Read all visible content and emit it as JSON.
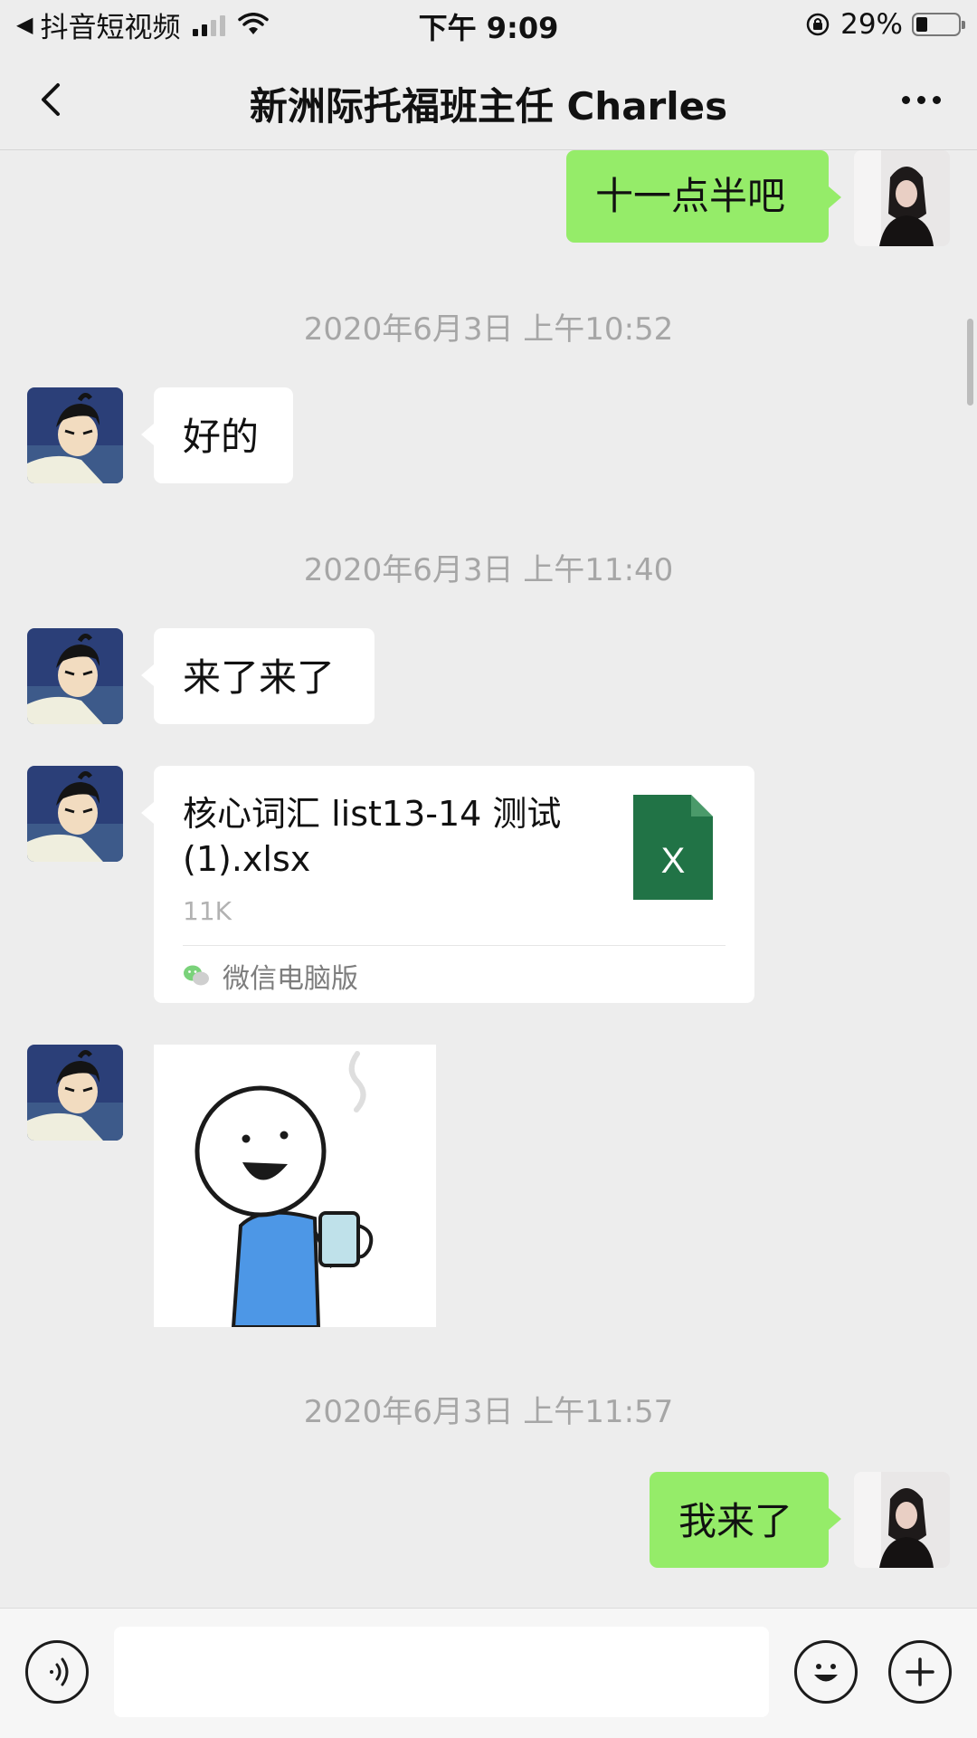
{
  "status_bar": {
    "back_app": "抖音短视频",
    "time": "下午 9:09",
    "battery_percent": "29%",
    "battery_level": 0.29,
    "signal_bars": 2
  },
  "nav": {
    "title": "新洲际托福班主任 Charles",
    "back_icon": "chevron-left-icon",
    "more_icon": "more-dots-icon"
  },
  "messages": [
    {
      "direction": "out",
      "type": "text",
      "text": "十一点半吧"
    },
    {
      "type": "time",
      "text": "2020年6月3日 上午10:52"
    },
    {
      "direction": "in",
      "type": "text",
      "text": "好的"
    },
    {
      "type": "time",
      "text": "2020年6月3日 上午11:40"
    },
    {
      "direction": "in",
      "type": "text",
      "text": "来了来了"
    },
    {
      "direction": "in",
      "type": "file",
      "file_name": "核心词汇 list13-14 测试(1).xlsx",
      "file_size": "11K",
      "file_icon_letter": "X",
      "source": "微信电脑版"
    },
    {
      "direction": "in",
      "type": "sticker",
      "sticker": "smiling-stick-figure-holding-cup"
    },
    {
      "type": "time",
      "text": "2020年6月3日 上午11:57"
    },
    {
      "direction": "out",
      "type": "text",
      "text": "我来了"
    }
  ],
  "input_bar": {
    "voice_icon": "voice-icon",
    "placeholder": "",
    "emoji_icon": "emoji-icon",
    "plus_icon": "plus-icon"
  },
  "colors": {
    "background": "#ededed",
    "outgoing_bubble": "#95ec69",
    "incoming_bubble": "#ffffff",
    "excel_green": "#217346"
  }
}
